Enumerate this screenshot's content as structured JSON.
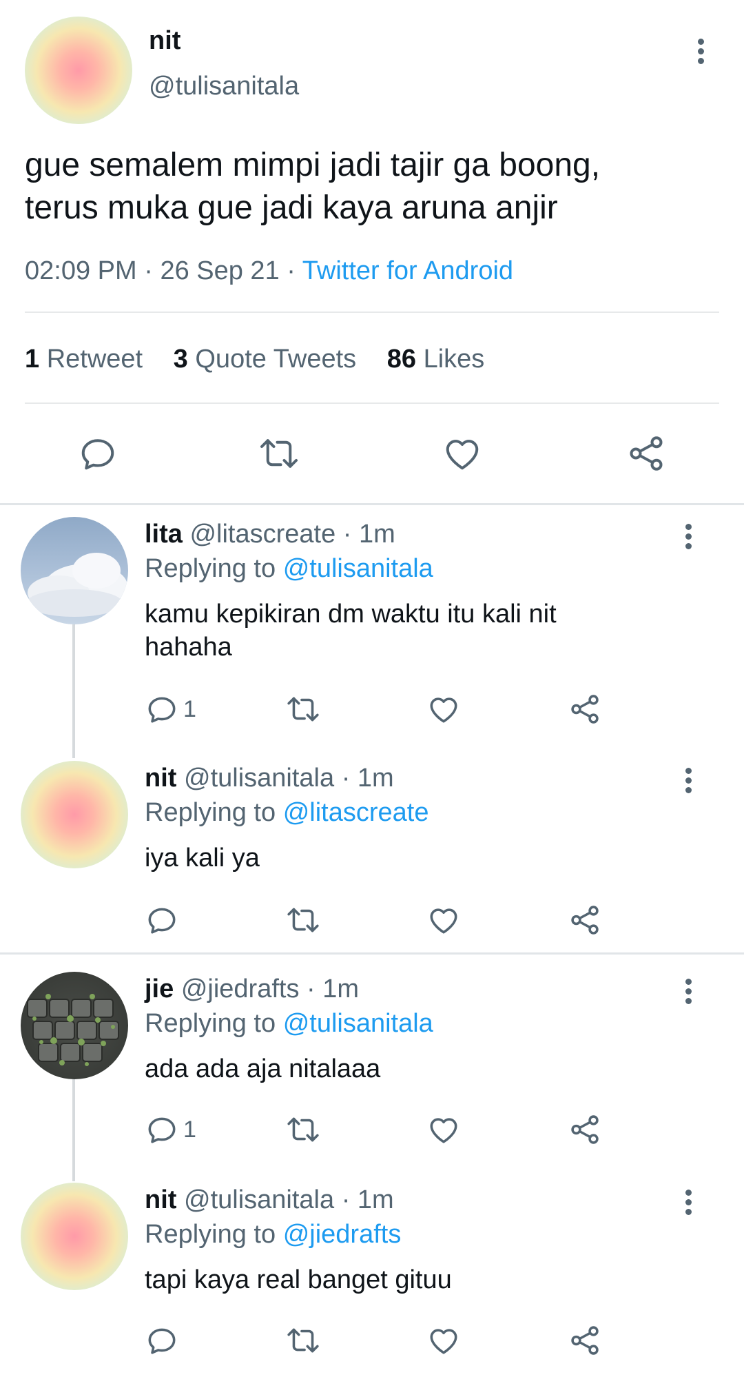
{
  "main_tweet": {
    "name": "nit",
    "handle": "@tulisanitala",
    "text_line1": "gue semalem mimpi jadi tajir ga boong,",
    "text_line2": "terus muka gue jadi kaya aruna anjir",
    "time": "02:09 PM",
    "date": "26 Sep 21",
    "sep": "·",
    "source": "Twitter for Android",
    "stats": {
      "retweets_count": "1",
      "retweets_label": "Retweet",
      "quotes_count": "3",
      "quotes_label": "Quote Tweets",
      "likes_count": "86",
      "likes_label": "Likes"
    }
  },
  "replies": [
    {
      "name": "lita",
      "handle": "@litascreate",
      "meta": "· 1m",
      "replying_prefix": "Replying to",
      "replying_to": "@tulisanitala",
      "text_line1": "kamu kepikiran dm waktu itu kali nit",
      "text_line2": "hahaha",
      "reply_count": "1",
      "avatar": "cloud-sky-photo"
    },
    {
      "name": "nit",
      "handle": "@tulisanitala",
      "meta": "· 1m",
      "replying_prefix": "Replying to",
      "replying_to": "@litascreate",
      "text_line1": "iya kali ya",
      "reply_count": "",
      "avatar": "gradient"
    },
    {
      "name": "jie",
      "handle": "@jiedrafts",
      "meta": "· 1m",
      "replying_prefix": "Replying to",
      "replying_to": "@tulisanitala",
      "text_line1": "ada ada aja nitalaaa",
      "reply_count": "1",
      "avatar": "mossy-keyboard-photo"
    },
    {
      "name": "nit",
      "handle": "@tulisanitala",
      "meta": "· 1m",
      "replying_prefix": "Replying to",
      "replying_to": "@jiedrafts",
      "text_line1": "tapi kaya real banget gituu",
      "reply_count": "",
      "avatar": "gradient"
    }
  ],
  "icons": {
    "reply": "reply-icon",
    "retweet": "retweet-icon",
    "like": "heart-icon",
    "share": "share-icon",
    "more": "more-vertical-icon"
  },
  "colors": {
    "text": "#0f1419",
    "secondary": "#536471",
    "link": "#1d9bf0",
    "divider": "#e7e9ea"
  }
}
